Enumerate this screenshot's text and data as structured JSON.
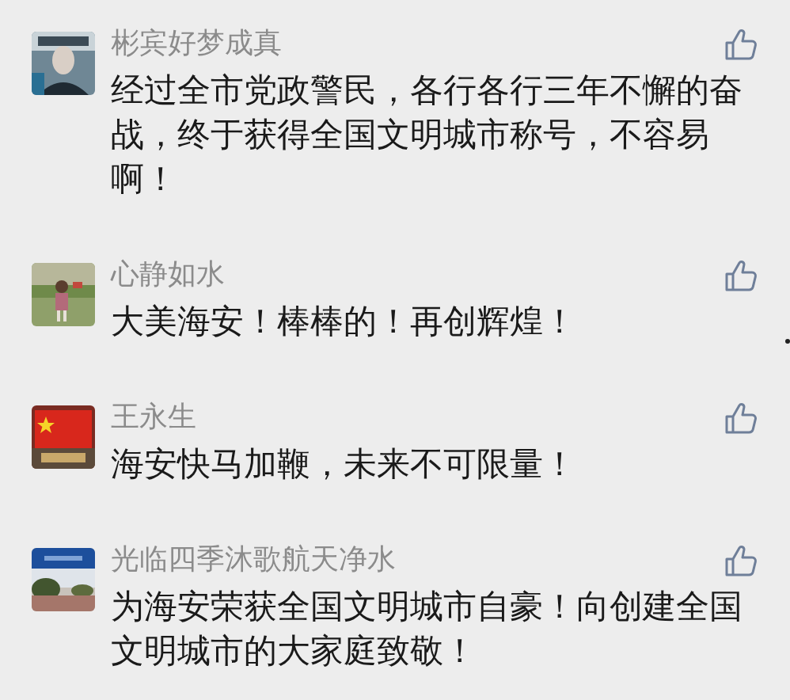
{
  "comments": [
    {
      "name": "彬宾好梦成真",
      "text": "经过全市党政警民，各行各行三年不懈的奋战，终于获得全国文明城市称号，不容易啊！"
    },
    {
      "name": "心静如水",
      "text": "大美海安！棒棒的！再创辉煌！"
    },
    {
      "name": "王永生",
      "text": "海安快马加鞭，未来不可限量！"
    },
    {
      "name": "光临四季沐歌航天净水",
      "text": "为海安荣获全国文明城市自豪！向创建全国文明城市的大家庭致敬！"
    }
  ]
}
